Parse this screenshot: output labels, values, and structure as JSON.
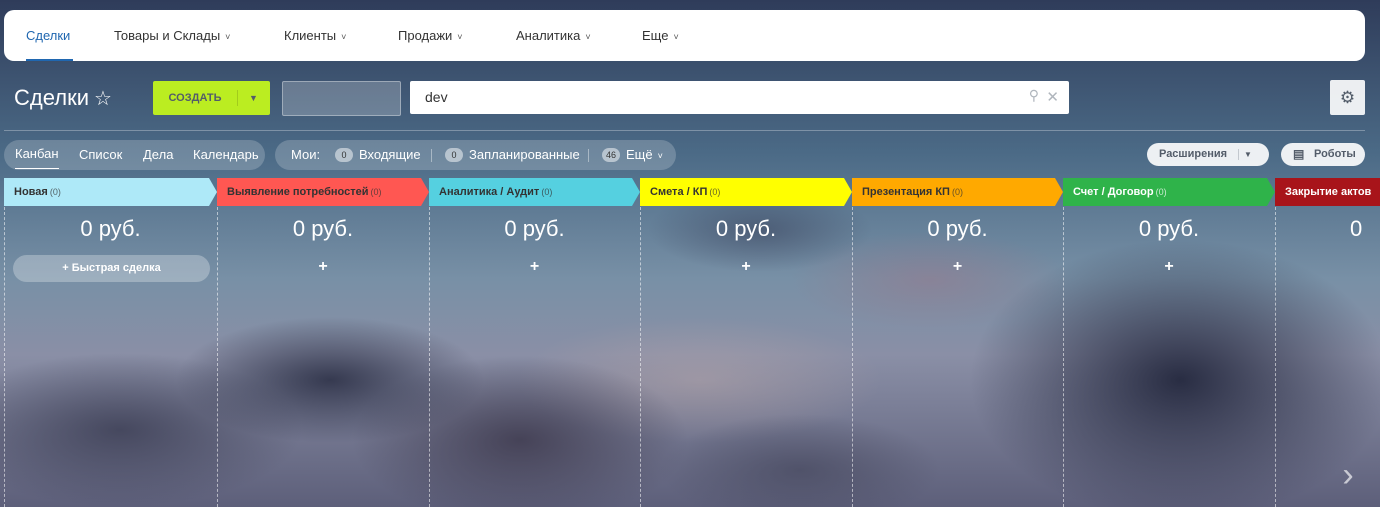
{
  "nav": {
    "items": [
      {
        "label": "Сделки",
        "has_chevron": false,
        "active": true
      },
      {
        "label": "Товары и Склады",
        "has_chevron": true
      },
      {
        "label": "Клиенты",
        "has_chevron": true
      },
      {
        "label": "Продажи",
        "has_chevron": true
      },
      {
        "label": "Аналитика",
        "has_chevron": true
      },
      {
        "label": "Еще",
        "has_chevron": true
      }
    ]
  },
  "toolbar": {
    "title": "Сделки",
    "create_label": "СОЗДАТЬ",
    "search_value": "dev",
    "search_placeholder": ""
  },
  "views": {
    "items": [
      "Канбан",
      "Список",
      "Дела",
      "Календарь"
    ],
    "active": "Канбан"
  },
  "counters": {
    "label": "Мои:",
    "items": [
      {
        "count": "0",
        "label": "Входящие"
      },
      {
        "count": "0",
        "label": "Запланированные"
      },
      {
        "count": "46",
        "label": "Ещё"
      }
    ]
  },
  "actions": {
    "extensions_label": "Расширения",
    "robots_label": "Роботы"
  },
  "kanban": {
    "quick_deal_label": "+ Быстрая сделка",
    "add_symbol": "+",
    "stages": [
      {
        "name": "Новая",
        "count": "(0)",
        "sum": "0 руб.",
        "color": "#aee9f8",
        "text_color": "#333333"
      },
      {
        "name": "Выявление потребностей",
        "count": "(0)",
        "sum": "0 руб.",
        "color": "#ff5752",
        "text_color": "#333333"
      },
      {
        "name": "Аналитика / Аудит",
        "count": "(0)",
        "sum": "0 руб.",
        "color": "#55d0e0",
        "text_color": "#333333"
      },
      {
        "name": "Смета / КП",
        "count": "(0)",
        "sum": "0 руб.",
        "color": "#ffff00",
        "text_color": "#333333"
      },
      {
        "name": "Презентация КП",
        "count": "(0)",
        "sum": "0 руб.",
        "color": "#ffa900",
        "text_color": "#333333"
      },
      {
        "name": "Счет / Договор",
        "count": "(0)",
        "sum": "0 руб.",
        "color": "#2fb34a",
        "text_color": "#ffffff"
      },
      {
        "name": "Закрытие актов",
        "count": "",
        "sum": "0",
        "color": "#a8141a",
        "text_color": "#ffffff"
      }
    ]
  },
  "colors": {
    "accent": "#2067b0",
    "create_button": "#bbed21"
  },
  "icons": {
    "favorite": "star-outline-icon",
    "search": "search-icon",
    "clear": "close-icon",
    "settings": "gear-icon",
    "robots": "robot-icon",
    "scroll": "chevron-right-icon"
  }
}
